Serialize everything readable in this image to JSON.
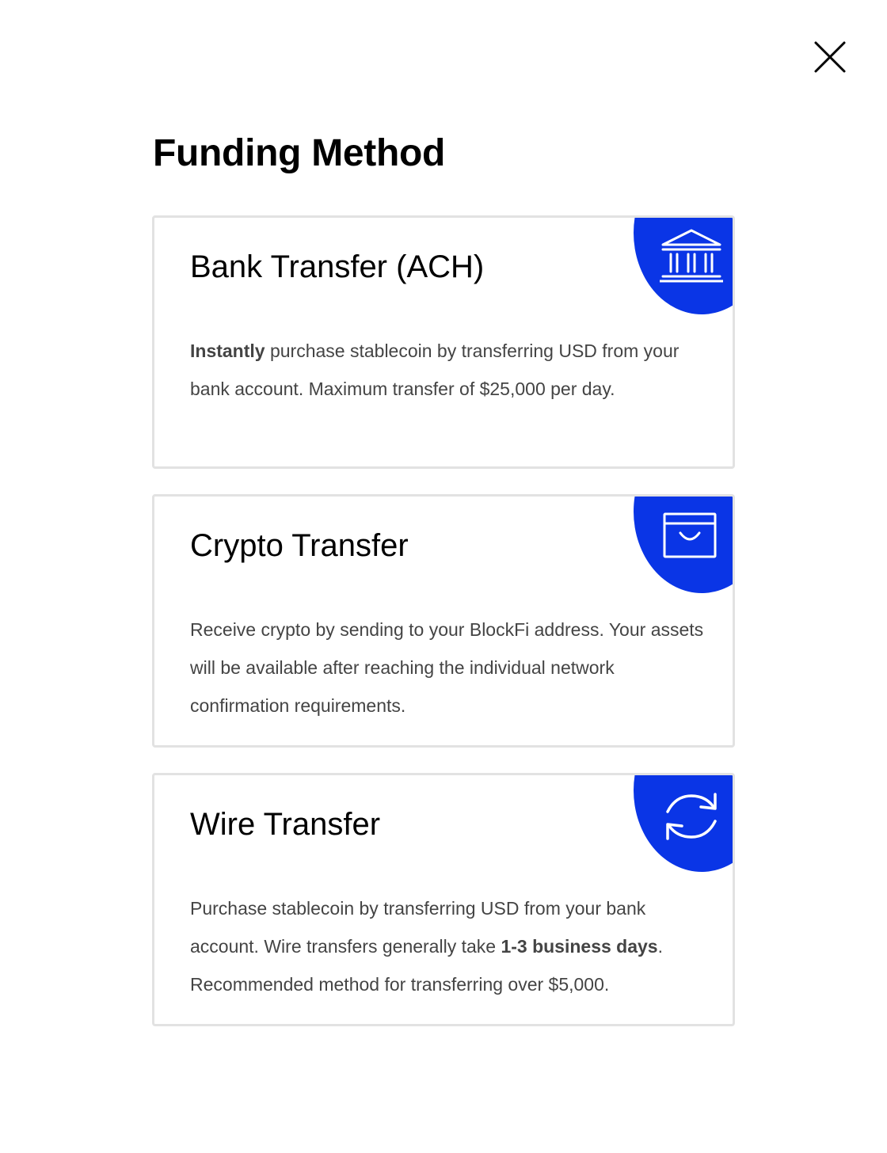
{
  "page": {
    "title": "Funding Method",
    "close_icon": "close-icon"
  },
  "colors": {
    "accent": "#0a35e6",
    "card_border": "#e2e2e2",
    "body_text": "#444444"
  },
  "methods": [
    {
      "title": "Bank Transfer (ACH)",
      "icon": "bank-icon",
      "desc_bold_lead": "Instantly",
      "desc_part1": " purchase stablecoin by transferring USD from your bank account. Maximum transfer of $25,000 per day.",
      "desc_bold_mid": "",
      "desc_part2": ""
    },
    {
      "title": "Crypto Transfer",
      "icon": "wallet-icon",
      "desc_bold_lead": "",
      "desc_part1": "Receive crypto by sending to your BlockFi address. Your assets will be available after reaching the individual network confirmation requirements.",
      "desc_bold_mid": "",
      "desc_part2": ""
    },
    {
      "title": "Wire Transfer",
      "icon": "refresh-icon",
      "desc_bold_lead": "",
      "desc_part1": "Purchase stablecoin by transferring USD from your bank account. Wire transfers generally take ",
      "desc_bold_mid": "1-3 business days",
      "desc_part2": ". Recommended method for transferring over $5,000."
    }
  ]
}
